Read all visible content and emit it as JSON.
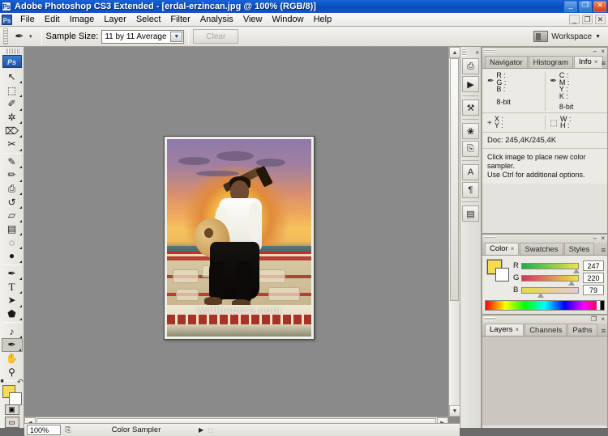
{
  "window": {
    "title": "Adobe Photoshop CS3 Extended - [erdal-erzincan.jpg @ 100% (RGB/8)]",
    "app_badge": "Ps",
    "controls": {
      "minimize": "_",
      "restore": "❐",
      "close": "✕"
    }
  },
  "menu": {
    "badge": "Ps",
    "items": [
      {
        "label": "File"
      },
      {
        "label": "Edit"
      },
      {
        "label": "Image"
      },
      {
        "label": "Layer"
      },
      {
        "label": "Select"
      },
      {
        "label": "Filter"
      },
      {
        "label": "Analysis"
      },
      {
        "label": "View"
      },
      {
        "label": "Window"
      },
      {
        "label": "Help"
      }
    ],
    "doc_controls": {
      "minimize": "_",
      "restore": "❐",
      "close": "✕"
    }
  },
  "options_bar": {
    "tool_icon": "color-sampler-icon",
    "tool_glyph": "✒",
    "caret": "▾",
    "sample_size_label": "Sample Size:",
    "sample_size_value": "11 by 11 Average",
    "dropdown_arrow": "▼",
    "clear_label": "Clear",
    "workspace_label": "Workspace",
    "workspace_caret": "▼"
  },
  "toolbar": {
    "logo": "Ps",
    "tools": [
      {
        "name": "move-tool",
        "glyph": "↖",
        "has_flyout": true,
        "selected": false
      },
      {
        "name": "marquee-tool",
        "glyph": "⬚",
        "has_flyout": true,
        "selected": false
      },
      {
        "name": "lasso-tool",
        "glyph": "✐",
        "has_flyout": true,
        "selected": false
      },
      {
        "name": "magic-wand-tool",
        "glyph": "✲",
        "has_flyout": true,
        "selected": false
      },
      {
        "name": "crop-tool",
        "glyph": "⌦",
        "has_flyout": true,
        "selected": false
      },
      {
        "name": "slice-tool",
        "glyph": "✂",
        "has_flyout": true,
        "selected": false
      },
      {
        "name": "healing-brush-tool",
        "glyph": "✎",
        "has_flyout": true,
        "selected": false
      },
      {
        "name": "brush-tool",
        "glyph": "✏",
        "has_flyout": true,
        "selected": false
      },
      {
        "name": "clone-stamp-tool",
        "glyph": "⎙",
        "has_flyout": true,
        "selected": false
      },
      {
        "name": "history-brush-tool",
        "glyph": "↺",
        "has_flyout": true,
        "selected": false
      },
      {
        "name": "eraser-tool",
        "glyph": "▱",
        "has_flyout": true,
        "selected": false
      },
      {
        "name": "gradient-tool",
        "glyph": "▤",
        "has_flyout": true,
        "selected": false
      },
      {
        "name": "blur-tool",
        "glyph": "◌",
        "has_flyout": true,
        "selected": false
      },
      {
        "name": "dodge-tool",
        "glyph": "●",
        "has_flyout": true,
        "selected": false
      },
      {
        "name": "pen-tool",
        "glyph": "✒",
        "has_flyout": true,
        "selected": false
      },
      {
        "name": "type-tool",
        "glyph": "T",
        "has_flyout": true,
        "selected": false
      },
      {
        "name": "path-selection-tool",
        "glyph": "➤",
        "has_flyout": true,
        "selected": false
      },
      {
        "name": "shape-tool",
        "glyph": "⬟",
        "has_flyout": true,
        "selected": false
      },
      {
        "name": "notes-tool",
        "glyph": "♪",
        "has_flyout": true,
        "selected": false
      },
      {
        "name": "color-sampler-tool",
        "glyph": "✒",
        "has_flyout": true,
        "selected": true
      },
      {
        "name": "hand-tool",
        "glyph": "✋",
        "has_flyout": false,
        "selected": false
      },
      {
        "name": "zoom-tool",
        "glyph": "⚲",
        "has_flyout": false,
        "selected": false
      }
    ],
    "foreground_color": "#f7dc4f",
    "background_color": "#ffffff",
    "quickmask_glyph": "▣",
    "screenmode_glyph": "▭"
  },
  "document": {
    "zoom": "100%",
    "filename": "erdal-erzincan.jpg",
    "watermark": "wallpapers.com",
    "image_description": "Man seated on stone steps playing an oud at sunset"
  },
  "dock_column": {
    "expand_glyph": "»",
    "buttons": [
      {
        "name": "dock-history-button",
        "glyph": "⎙"
      },
      {
        "name": "dock-actions-button",
        "glyph": "▶"
      },
      {
        "name": "dock-tool-presets-button",
        "glyph": "⚒"
      },
      {
        "name": "dock-brushes-button",
        "glyph": "❀"
      },
      {
        "name": "dock-clone-source-button",
        "glyph": "⎘"
      },
      {
        "name": "dock-character-button",
        "glyph": "A"
      },
      {
        "name": "dock-paragraph-button",
        "glyph": "¶"
      },
      {
        "name": "dock-layer-comps-button",
        "glyph": "▤"
      }
    ]
  },
  "info_panel": {
    "tabs": [
      {
        "label": "Navigator",
        "active": false,
        "closable": false
      },
      {
        "label": "Histogram",
        "active": false,
        "closable": false
      },
      {
        "label": "Info",
        "active": true,
        "closable": true
      }
    ],
    "close_glyph": "×",
    "menu_glyph": "≡",
    "minimize_glyph": "–",
    "panel_close_glyph": "×",
    "left_readout": {
      "eyedropper": "✒",
      "rows": [
        "R :",
        "G :",
        "B :"
      ],
      "bit": "8-bit"
    },
    "right_readout": {
      "eyedropper": "✒",
      "rows": [
        "C :",
        "M :",
        "Y :",
        "K :"
      ],
      "bit": "8-bit"
    },
    "position_readout": {
      "icon": "+",
      "rows": [
        "X :",
        "Y :"
      ]
    },
    "size_readout": {
      "icon": "⬚",
      "rows": [
        "W :",
        "H :"
      ]
    },
    "doc_size": "Doc: 245,4K/245,4K",
    "hint_line1": "Click image to place new color sampler.",
    "hint_line2": "Use Ctrl for additional options."
  },
  "color_panel": {
    "tabs": [
      {
        "label": "Color",
        "active": true,
        "closable": true
      },
      {
        "label": "Swatches",
        "active": false,
        "closable": false
      },
      {
        "label": "Styles",
        "active": false,
        "closable": false
      }
    ],
    "close_glyph": "×",
    "menu_glyph": "≡",
    "minimize_glyph": "–",
    "panel_close_glyph": "×",
    "foreground_color": "#f7dc4f",
    "background_color": "#ffffff",
    "sliders": [
      {
        "label": "R",
        "value": "247",
        "pct": 96.9
      },
      {
        "label": "G",
        "value": "220",
        "pct": 86.3
      },
      {
        "label": "B",
        "value": "79",
        "pct": 31.0
      }
    ]
  },
  "layers_panel": {
    "tabs": [
      {
        "label": "Layers",
        "active": true,
        "closable": true
      },
      {
        "label": "Channels",
        "active": false,
        "closable": false
      },
      {
        "label": "Paths",
        "active": false,
        "closable": false
      }
    ],
    "close_glyph": "×",
    "menu_glyph": "≡",
    "minimize_glyph": "❐",
    "panel_close_glyph": "×"
  },
  "status_bar": {
    "zoom_value": "100%",
    "doc_icon": "⎘",
    "tool_name": "Color Sampler",
    "arrow_glyph": "▶",
    "mode_glyph": "□"
  },
  "scrollbars": {
    "up": "▲",
    "down": "▼",
    "left": "◀",
    "right": "▶"
  }
}
